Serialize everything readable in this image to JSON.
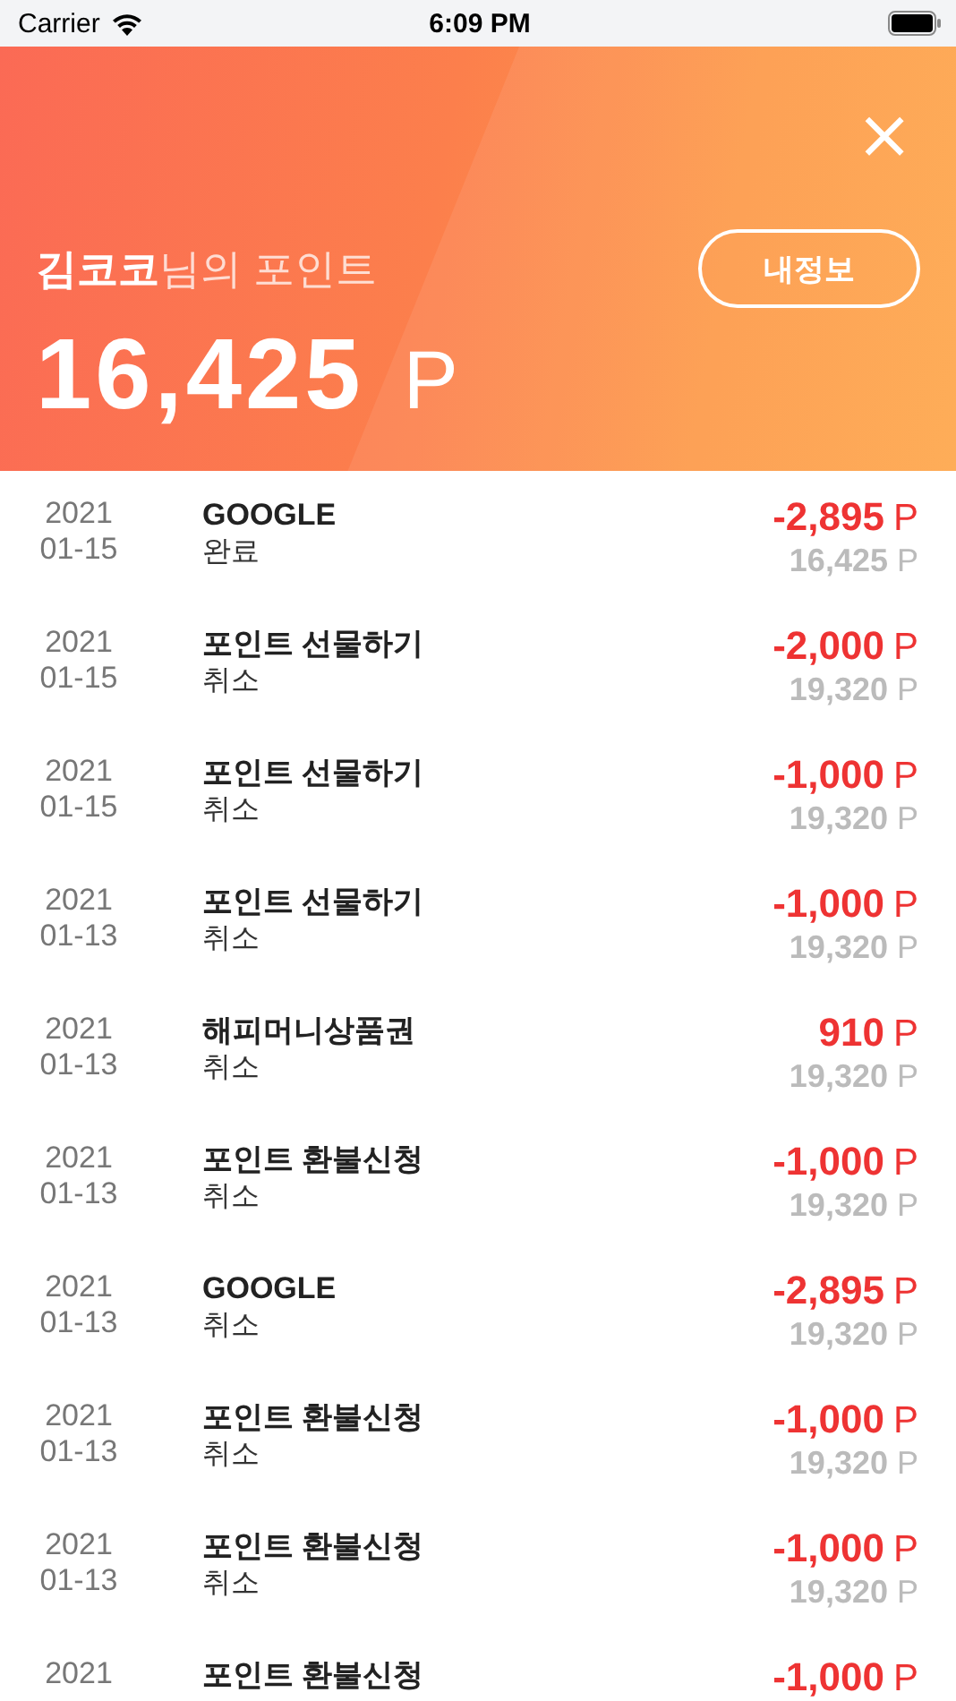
{
  "status_bar": {
    "carrier": "Carrier",
    "time": "6:09 PM"
  },
  "header": {
    "close": "×",
    "title": "**김코코**님의 포인트",
    "button": "내정보",
    "points": "16,425",
    "unit": "P"
  },
  "history": [
    {
      "year": "2021",
      "date": "01-15",
      "title": "GOOGLE",
      "status": "완료",
      "amount": "-2,895",
      "amount_unit": "P",
      "balance": "16,425",
      "balance_unit": "P"
    },
    {
      "year": "2021",
      "date": "01-15",
      "title": "포인트 선물하기",
      "status": "취소",
      "amount": "-2,000",
      "amount_unit": "P",
      "balance": "19,320",
      "balance_unit": "P"
    },
    {
      "year": "2021",
      "date": "01-15",
      "title": "포인트 선물하기",
      "status": "취소",
      "amount": "-1,000",
      "amount_unit": "P",
      "balance": "19,320",
      "balance_unit": "P"
    },
    {
      "year": "2021",
      "date": "01-13",
      "title": "포인트 선물하기",
      "status": "취소",
      "amount": "-1,000",
      "amount_unit": "P",
      "balance": "19,320",
      "balance_unit": "P"
    },
    {
      "year": "2021",
      "date": "01-13",
      "title": "해피머니상품권",
      "status": "취소",
      "amount": "910",
      "amount_unit": "P",
      "balance": "19,320",
      "balance_unit": "P"
    },
    {
      "year": "2021",
      "date": "01-13",
      "title": "포인트 환불신청",
      "status": "취소",
      "amount": "-1,000",
      "amount_unit": "P",
      "balance": "19,320",
      "balance_unit": "P"
    },
    {
      "year": "2021",
      "date": "01-13",
      "title": "GOOGLE",
      "status": "취소",
      "amount": "-2,895",
      "amount_unit": "P",
      "balance": "19,320",
      "balance_unit": "P"
    },
    {
      "year": "2021",
      "date": "01-13",
      "title": "포인트 환불신청",
      "status": "취소",
      "amount": "-1,000",
      "amount_unit": "P",
      "balance": "19,320",
      "balance_unit": "P"
    },
    {
      "year": "2021",
      "date": "01-13",
      "title": "포인트 환불신청",
      "status": "취소",
      "amount": "-1,000",
      "amount_unit": "P",
      "balance": "19,320",
      "balance_unit": "P"
    },
    {
      "year": "2021",
      "title": "포인트 환불신청",
      "amount": "-1,000",
      "amount_unit": "P"
    }
  ]
}
